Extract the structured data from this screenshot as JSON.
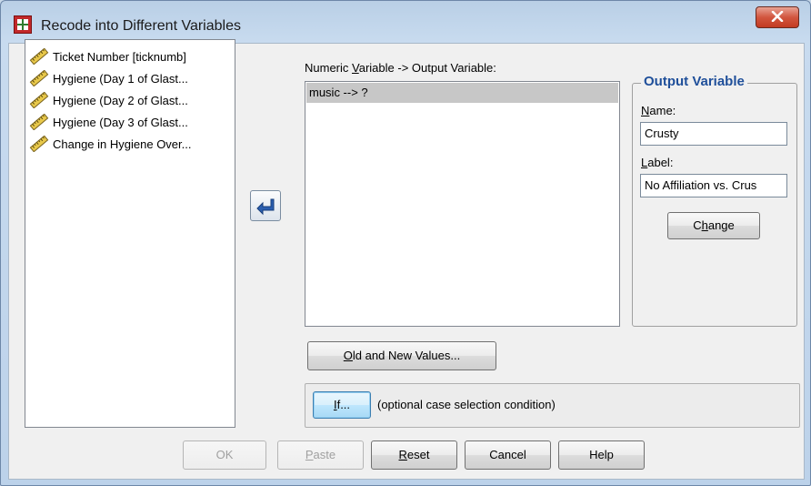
{
  "window": {
    "title": "Recode into Different Variables"
  },
  "source_variables": [
    {
      "label": "Ticket Number [ticknumb]",
      "icon": "scale-ruler-icon"
    },
    {
      "label": "Hygiene (Day 1 of Glast...",
      "icon": "scale-ruler-icon"
    },
    {
      "label": "Hygiene (Day 2 of Glast...",
      "icon": "scale-ruler-icon"
    },
    {
      "label": "Hygiene (Day 3 of Glast...",
      "icon": "scale-ruler-icon"
    },
    {
      "label": "Change in Hygiene Over...",
      "icon": "scale-ruler-icon"
    }
  ],
  "mapping": {
    "label_pre": "Numeric ",
    "label_key": "V",
    "label_post": "ariable -> Output Variable:",
    "rows": [
      "music --> ?"
    ]
  },
  "output_variable": {
    "title": "Output Variable",
    "name_label_key": "N",
    "name_label_rest": "ame:",
    "name_value": "Crusty",
    "label_label_key": "L",
    "label_label_rest": "abel:",
    "label_value": "No Affiliation vs. Crus",
    "change_pre": "C",
    "change_key": "h",
    "change_post": "ange"
  },
  "old_new_button": {
    "key": "O",
    "rest": "ld and New Values..."
  },
  "if_section": {
    "key": "I",
    "rest": "f...",
    "note": "(optional case selection condition)"
  },
  "footer": {
    "ok": "OK",
    "paste_key": "P",
    "paste_rest": "aste",
    "reset_key": "R",
    "reset_rest": "eset",
    "cancel": "Cancel",
    "help": "Help"
  },
  "colors": {
    "group_title": "#1f4f9a",
    "close_button": "#c23a22",
    "selection": "#c7c7c7"
  }
}
